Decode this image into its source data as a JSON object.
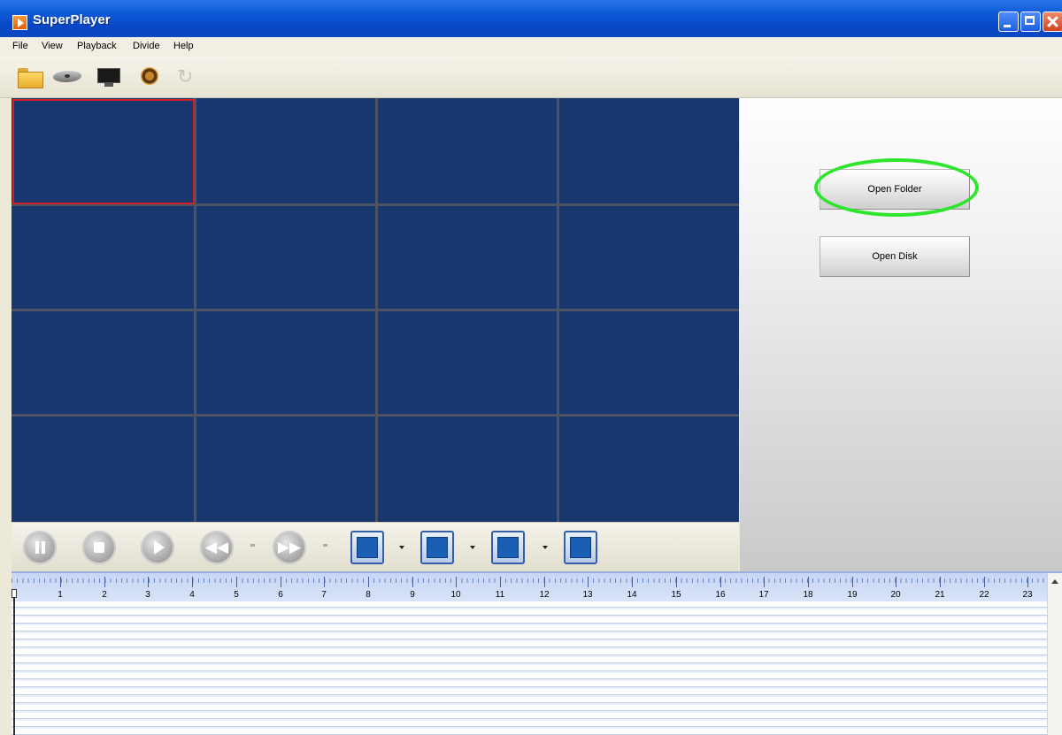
{
  "window": {
    "title": "SuperPlayer"
  },
  "menu": {
    "items": [
      "File",
      "View",
      "Playback",
      "Divide",
      "Help"
    ]
  },
  "toolbar": {
    "icons": [
      "folder-icon",
      "disk-icon",
      "monitor-icon",
      "settings-icon",
      "refresh-icon"
    ]
  },
  "video_grid": {
    "rows": 4,
    "cols": 4,
    "selected_cell": 1,
    "background": "#17376e",
    "selected_border": "#d21e2b"
  },
  "playback_controls": {
    "buttons": [
      "pause",
      "stop",
      "play",
      "rewind",
      "fast-forward"
    ],
    "split_modes": [
      "1",
      "4",
      "9",
      "16"
    ]
  },
  "right_panel": {
    "open_folder_label": "Open Folder",
    "open_disk_label": "Open Disk",
    "highlight_color": "#2de52a"
  },
  "timeline": {
    "hours": [
      "1",
      "2",
      "3",
      "4",
      "5",
      "6",
      "7",
      "8",
      "9",
      "10",
      "11",
      "12",
      "13",
      "14",
      "15",
      "16",
      "17",
      "18",
      "19",
      "20",
      "21",
      "22",
      "23"
    ]
  }
}
